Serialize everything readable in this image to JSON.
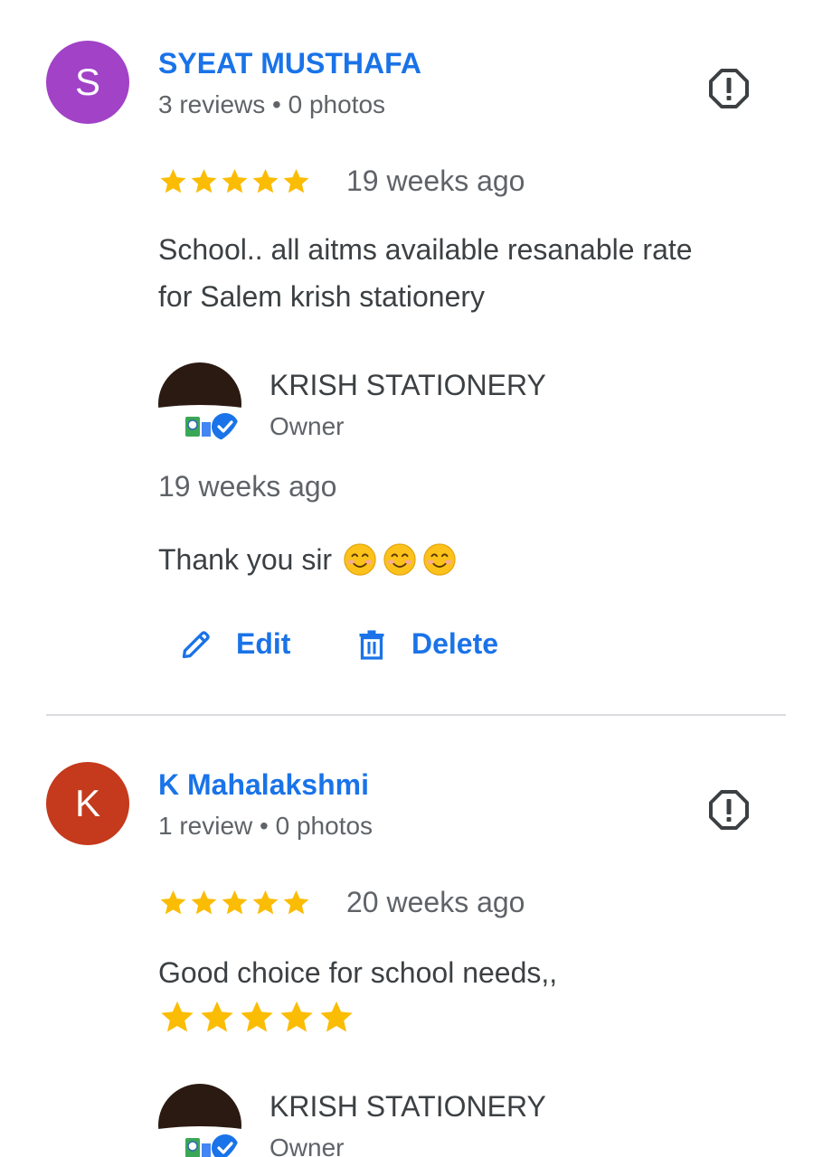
{
  "colors": {
    "link_blue": "#1a73e8",
    "star_gold": "#fbbc04",
    "avatar_s": "#a142c7",
    "avatar_k": "#c5391c"
  },
  "reviews": [
    {
      "avatar_letter": "S",
      "author": "SYEAT MUSTHAFA",
      "meta": "3 reviews • 0 photos",
      "rating": 5,
      "time": "19 weeks ago",
      "text_line1": "School.. all aitms available resanable rate",
      "text_line2": "for Salem krish stationery",
      "owner": {
        "name": "KRISH STATIONERY",
        "label": "Owner",
        "time": "19 weeks ago",
        "reply": "Thank you sir"
      },
      "actions": {
        "edit": "Edit",
        "delete": "Delete"
      }
    },
    {
      "avatar_letter": "K",
      "author": "K Mahalakshmi",
      "meta": "1 review • 0 photos",
      "rating": 5,
      "time": "20 weeks ago",
      "text_line1": "Good choice for school needs,,",
      "owner": {
        "name": "KRISH STATIONERY",
        "label": "Owner"
      }
    }
  ]
}
